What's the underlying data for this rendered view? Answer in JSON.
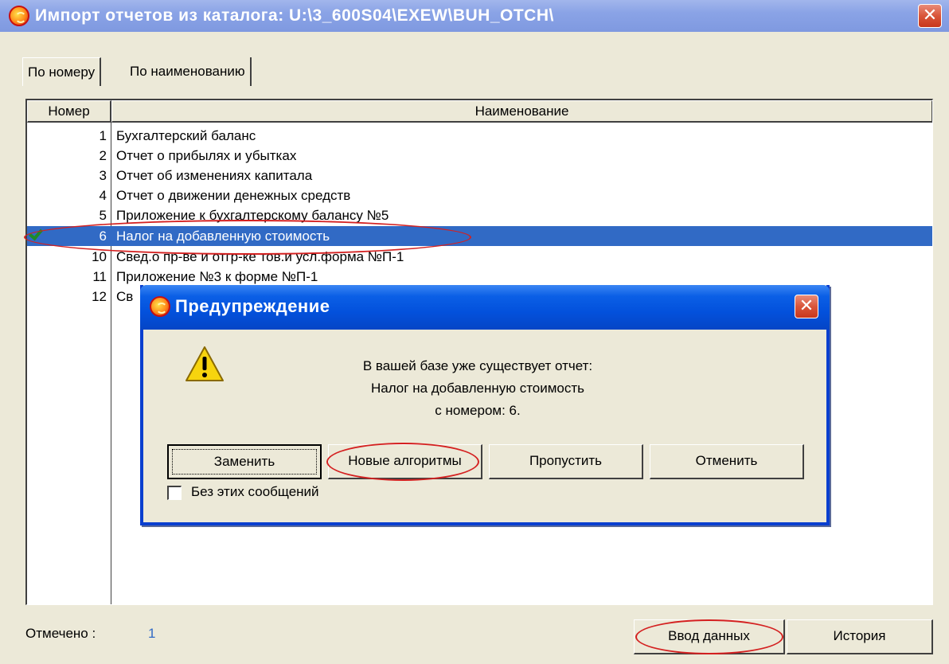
{
  "window": {
    "title": "Импорт отчетов из каталога:  U:\\3_600S04\\EXEW\\BUH_OTCH\\",
    "close": "✕"
  },
  "tabs": [
    {
      "label": "По номеру"
    },
    {
      "label": "По наименованию"
    }
  ],
  "table": {
    "columns": [
      "Номер",
      "Наименование"
    ],
    "rows": [
      {
        "num": "1",
        "name": "Бухгалтерский баланс"
      },
      {
        "num": "2",
        "name": "Отчет о прибылях и убытках"
      },
      {
        "num": "3",
        "name": "Отчет об изменениях капитала"
      },
      {
        "num": "4",
        "name": "Отчет о движении денежных средств"
      },
      {
        "num": "5",
        "name": "Приложение к бухгалтерскому балансу №5"
      },
      {
        "num": "6",
        "name": "Налог на добавленную стоимость"
      },
      {
        "num": "10",
        "name": "Свед.о пр-ве и отгр-ке тов.и усл.форма №П-1"
      },
      {
        "num": "11",
        "name": "Приложение №3 к форме №П-1"
      },
      {
        "num": "12",
        "name": "Св"
      }
    ]
  },
  "footer": {
    "marked_label": "Отмечено :",
    "marked_count": "1",
    "vvod_button": "Ввод данных",
    "history_button": "История"
  },
  "dialog": {
    "title": "Предупреждение",
    "close": "✕",
    "message_lines": [
      "В вашей базе уже существует отчет:",
      "Налог на добавленную стоимость",
      "с номером: 6."
    ],
    "buttons": {
      "replace": "Заменить",
      "new_algorithms": "Новые алгоритмы",
      "skip": "Пропустить",
      "cancel": "Отменить"
    },
    "checkbox_label": "Без этих сообщений"
  }
}
